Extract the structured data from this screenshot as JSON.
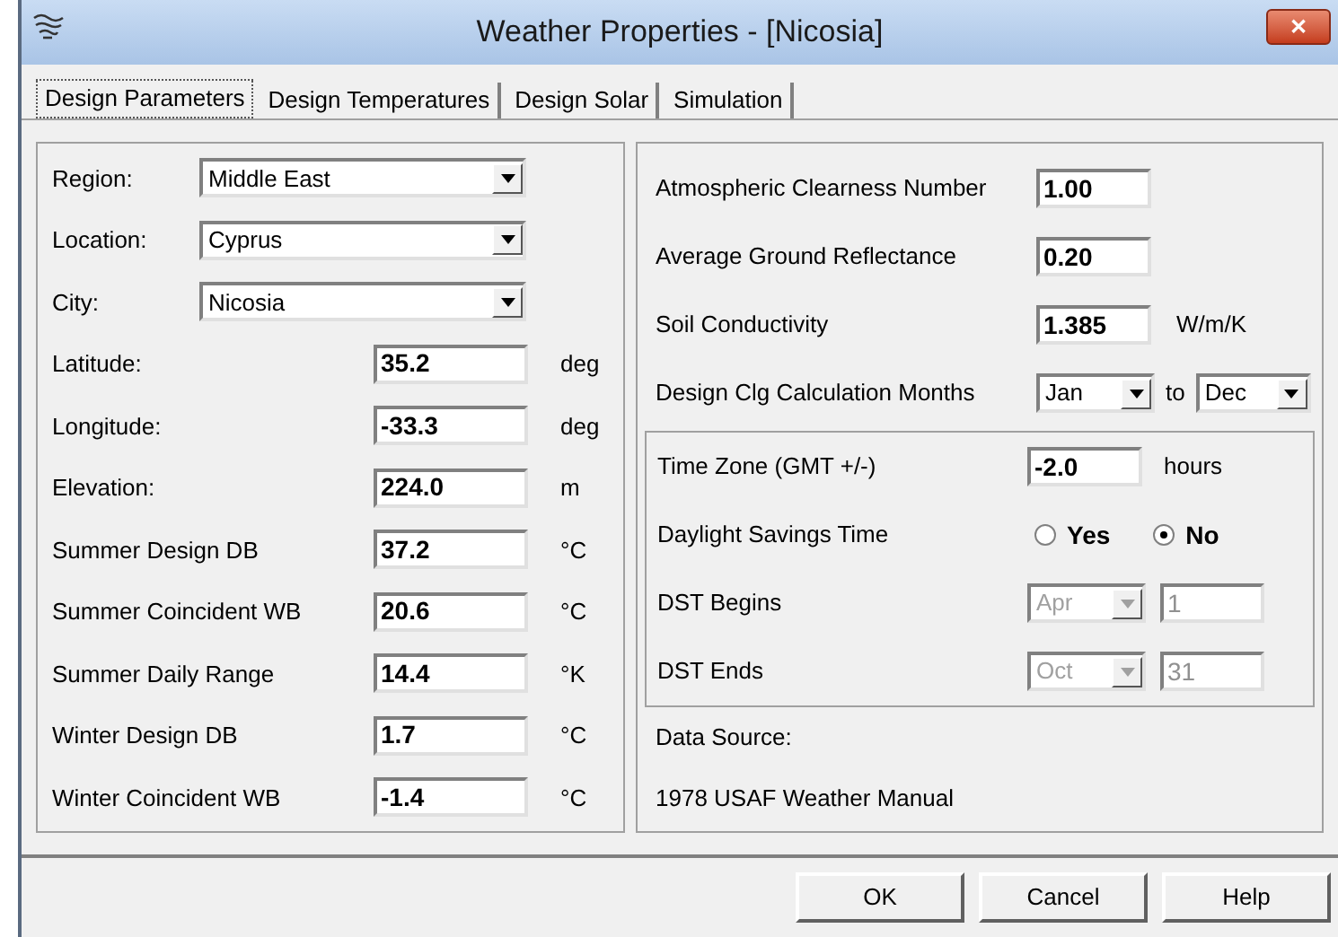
{
  "window": {
    "title": "Weather Properties - [Nicosia]",
    "close": "✕"
  },
  "tabs": [
    {
      "label": "Design Parameters",
      "selected": true
    },
    {
      "label": "Design Temperatures",
      "selected": false
    },
    {
      "label": "Design Solar",
      "selected": false
    },
    {
      "label": "Simulation",
      "selected": false
    }
  ],
  "location": [
    {
      "label": "Region:",
      "value": "Middle East"
    },
    {
      "label": "Location:",
      "value": "Cyprus"
    },
    {
      "label": "City:",
      "value": "Nicosia"
    }
  ],
  "design_values": [
    {
      "label": "Latitude:",
      "value": "35.2",
      "unit": "deg"
    },
    {
      "label": "Longitude:",
      "value": "-33.3",
      "unit": "deg"
    },
    {
      "label": "Elevation:",
      "value": "224.0",
      "unit": "m"
    },
    {
      "label": "Summer Design DB",
      "value": "37.2",
      "unit": "°C"
    },
    {
      "label": "Summer Coincident WB",
      "value": "20.6",
      "unit": "°C"
    },
    {
      "label": "Summer Daily Range",
      "value": "14.4",
      "unit": "°K"
    },
    {
      "label": "Winter Design DB",
      "value": "1.7",
      "unit": "°C"
    },
    {
      "label": "Winter Coincident WB",
      "value": "-1.4",
      "unit": "°C"
    }
  ],
  "solar": [
    {
      "label": "Atmospheric Clearness Number",
      "value": "1.00"
    },
    {
      "label": "Average Ground Reflectance",
      "value": "0.20"
    },
    {
      "label": "Soil Conductivity",
      "value": "1.385",
      "unit": "W/m/K"
    }
  ],
  "calc_months": {
    "label": "Design Clg Calculation Months",
    "from": "Jan",
    "to_label": "to",
    "to": "Dec"
  },
  "time_zone": {
    "label": "Time Zone (GMT +/-)",
    "value": "-2.0",
    "unit": "hours"
  },
  "daylight_savings": {
    "label": "Daylight Savings Time",
    "options": [
      {
        "label": "Yes",
        "selected": false
      },
      {
        "label": "No",
        "selected": true
      }
    ]
  },
  "dst": [
    {
      "label": "DST Begins",
      "month": "Apr",
      "day": "1",
      "disabled": true
    },
    {
      "label": "DST Ends",
      "month": "Oct",
      "day": "31",
      "disabled": true
    }
  ],
  "data_source": {
    "label": "Data Source:",
    "value": "1978 USAF Weather Manual"
  },
  "buttons": [
    "OK",
    "Cancel",
    "Help"
  ]
}
